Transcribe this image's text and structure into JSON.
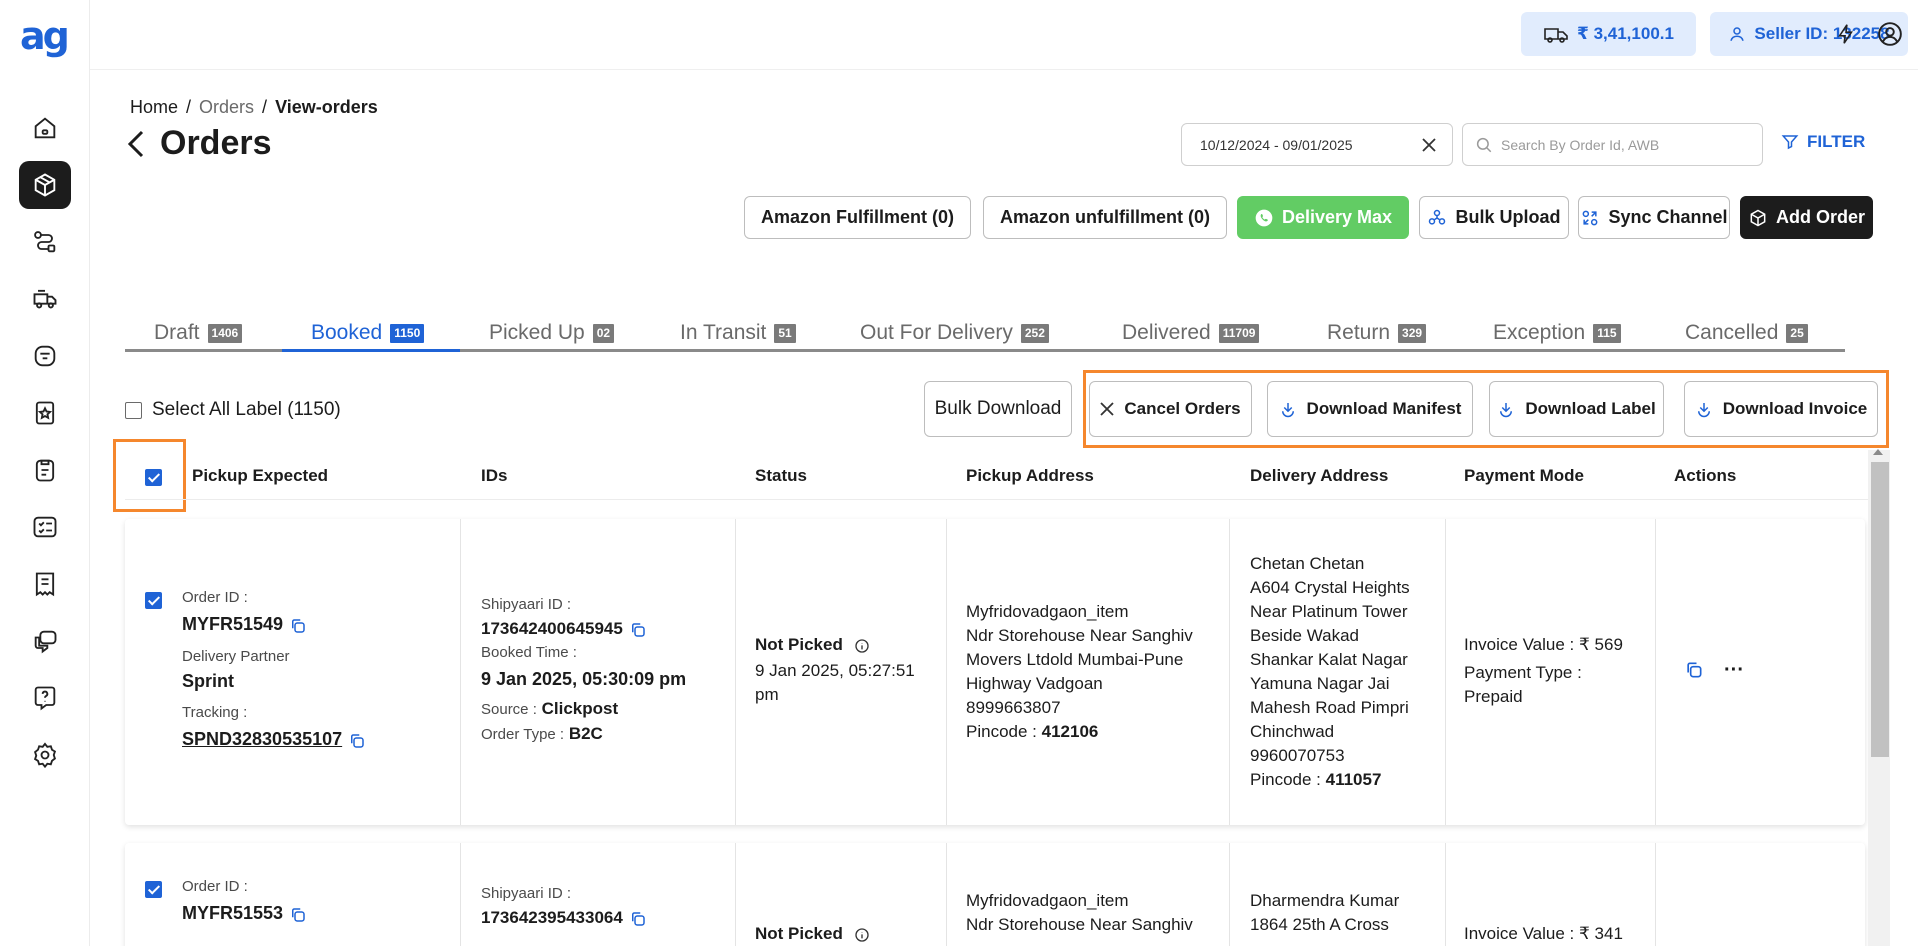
{
  "brand": {
    "logo_text": "ag",
    "accent": "#1f63d6",
    "highlight": "#f5872d"
  },
  "sidebar": {
    "items": [
      {
        "name": "home-icon"
      },
      {
        "name": "orders-box-icon",
        "active": true
      },
      {
        "name": "route-icon"
      },
      {
        "name": "delivery-truck-icon"
      },
      {
        "name": "wallet-icon"
      },
      {
        "name": "badge-star-icon"
      },
      {
        "name": "clipboard-icon"
      },
      {
        "name": "checklist-icon"
      },
      {
        "name": "receipt-icon"
      },
      {
        "name": "chat-icon"
      },
      {
        "name": "help-icon"
      },
      {
        "name": "settings-gear-icon"
      }
    ]
  },
  "header": {
    "wallet_balance": "₹ 3,41,100.1",
    "seller_id": "Seller ID: 132258"
  },
  "breadcrumb": {
    "home": "Home",
    "sep": "/",
    "orders": "Orders",
    "current": "View-orders"
  },
  "page": {
    "title": "Orders"
  },
  "filters": {
    "date_range": "10/12/2024 - 09/01/2025",
    "search_placeholder": "Search By Order Id, AWB",
    "filter_label": "FILTER"
  },
  "toolbar": {
    "amazon_fulfillment": "Amazon Fulfillment (0)",
    "amazon_unfulfillment": "Amazon unfulfillment (0)",
    "delivery_max": "Delivery Max",
    "bulk_upload": "Bulk Upload",
    "sync_channel": "Sync Channel",
    "add_order": "Add Order"
  },
  "tabs": [
    {
      "label": "Draft",
      "count": "1406"
    },
    {
      "label": "Booked",
      "count": "1150",
      "active": true
    },
    {
      "label": "Picked Up",
      "count": "02"
    },
    {
      "label": "In Transit",
      "count": "51"
    },
    {
      "label": "Out For Delivery",
      "count": "252"
    },
    {
      "label": "Delivered",
      "count": "11709"
    },
    {
      "label": "Return",
      "count": "329"
    },
    {
      "label": "Exception",
      "count": "115"
    },
    {
      "label": "Cancelled",
      "count": "25"
    }
  ],
  "bulk": {
    "select_all": "Select All Label (1150)",
    "bulk_download": "Bulk Download",
    "cancel_orders": "Cancel Orders",
    "download_manifest": "Download Manifest",
    "download_label": "Download Label",
    "download_invoice": "Download Invoice"
  },
  "table": {
    "headers": {
      "pickup_expected": "Pickup Expected",
      "ids": "IDs",
      "status": "Status",
      "pickup_address": "Pickup Address",
      "delivery_address": "Delivery Address",
      "payment_mode": "Payment Mode",
      "actions": "Actions"
    },
    "labels": {
      "order_id": "Order ID :",
      "delivery_partner": "Delivery Partner",
      "tracking": "Tracking :",
      "shipyaari_id": "Shipyaari ID :",
      "booked_time": "Booked Time :",
      "source": "Source :",
      "order_type": "Order Type :",
      "pincode": "Pincode :",
      "invoice_value": "Invoice Value :",
      "payment_type": "Payment Type :",
      "more": "···"
    },
    "rows": [
      {
        "order_id": "MYFR51549",
        "delivery_partner": "Sprint",
        "tracking": "SPND32830535107",
        "shipyaari_id": "173642400645945",
        "booked_time": "9 Jan 2025, 05:30:09 pm",
        "source": "Clickpost",
        "order_type": "B2C",
        "status": "Not Picked",
        "status_time_1": "9 Jan 2025, 05:27:51",
        "status_time_2": "pm",
        "pickup_lines": [
          "Myfridovadgaon_item",
          "Ndr Storehouse Near Sanghiv",
          "Movers Ltdold Mumbai-Pune",
          "Highway Vadgoan",
          "8999663807"
        ],
        "pickup_pincode": "412106",
        "delivery_lines": [
          "Chetan Chetan",
          "A604 Crystal Heights",
          "Near Platinum Tower",
          "Beside Wakad",
          "Shankar Kalat Nagar",
          "Yamuna Nagar Jai",
          "Mahesh Road Pimpri",
          "Chinchwad",
          "9960070753"
        ],
        "delivery_pincode": "411057",
        "invoice_value": "₹ 569",
        "payment_type": "Prepaid"
      },
      {
        "order_id": "MYFR51553",
        "shipyaari_id": "173642395433064",
        "status": "Not Picked",
        "pickup_lines": [
          "Myfridovadgaon_item",
          "Ndr Storehouse Near Sanghiv"
        ],
        "delivery_lines": [
          "Dharmendra Kumar",
          "1864 25th A Cross"
        ],
        "invoice_value": "₹ 341"
      }
    ]
  }
}
